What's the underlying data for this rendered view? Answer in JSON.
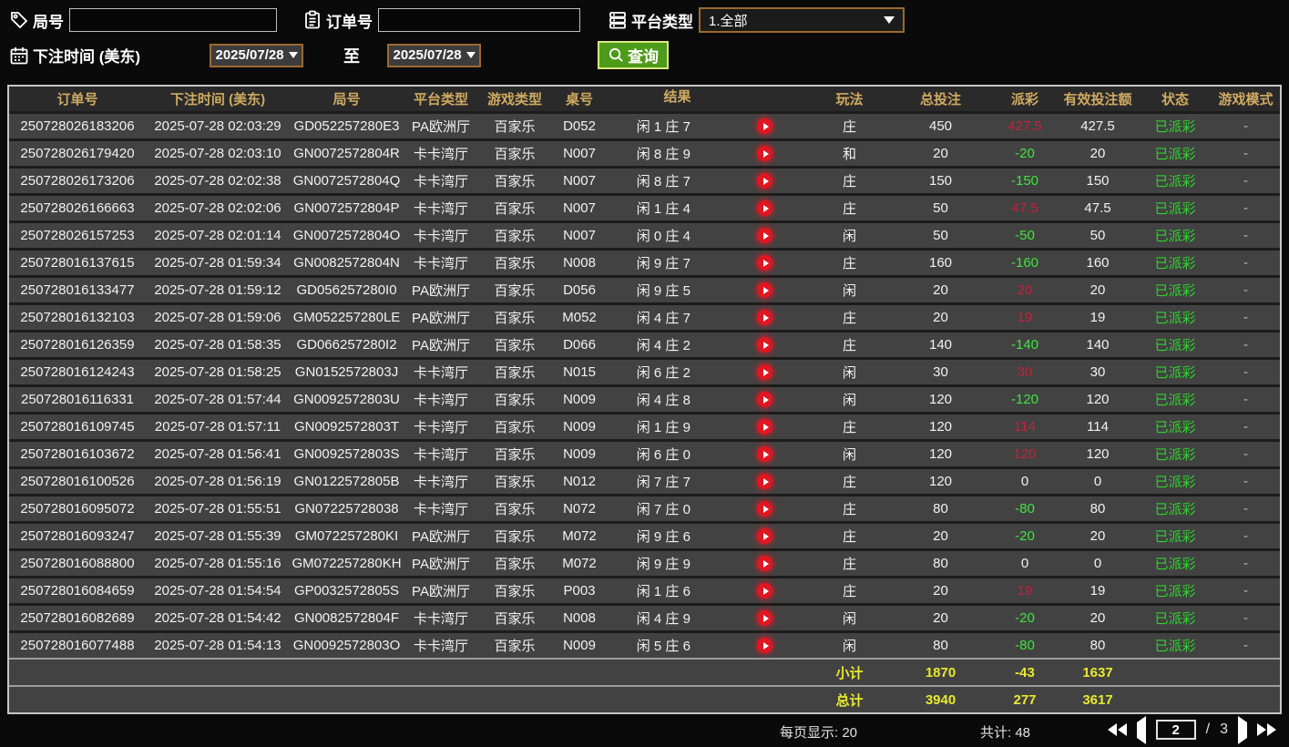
{
  "filters": {
    "game_no_label": "局号",
    "game_no_value": "",
    "order_no_label": "订单号",
    "order_no_value": "",
    "platform_type_label": "平台类型",
    "platform_type_value": "1.全部",
    "bet_time_label": "下注时间 (美东)",
    "date_from": "2025/07/28",
    "to_label": "至",
    "date_to": "2025/07/28",
    "search_button_label": "查询"
  },
  "table": {
    "columns": [
      "订单号",
      "下注时间 (美东)",
      "局号",
      "平台类型",
      "游戏类型",
      "桌号",
      "结果",
      "玩法",
      "总投注",
      "派彩",
      "有效投注额",
      "状态",
      "游戏模式"
    ],
    "rows": [
      {
        "order_no": "250728026183206",
        "bet_time": "2025-07-28 02:03:29",
        "game_no": "GD052257280E3",
        "platform": "PA欧洲厅",
        "game_type": "百家乐",
        "table_no": "D052",
        "result": "闲 1 庄 7",
        "play": "庄",
        "total_bet": "450",
        "payout": "427.5",
        "payout_class": "pos",
        "valid_bet": "427.5",
        "status": "已派彩",
        "game_mode": "-"
      },
      {
        "order_no": "250728026179420",
        "bet_time": "2025-07-28 02:03:10",
        "game_no": "GN0072572804R",
        "platform": "卡卡湾厅",
        "game_type": "百家乐",
        "table_no": "N007",
        "result": "闲 8 庄 9",
        "play": "和",
        "total_bet": "20",
        "payout": "-20",
        "payout_class": "neg",
        "valid_bet": "20",
        "status": "已派彩",
        "game_mode": "-"
      },
      {
        "order_no": "250728026173206",
        "bet_time": "2025-07-28 02:02:38",
        "game_no": "GN0072572804Q",
        "platform": "卡卡湾厅",
        "game_type": "百家乐",
        "table_no": "N007",
        "result": "闲 8 庄 7",
        "play": "庄",
        "total_bet": "150",
        "payout": "-150",
        "payout_class": "neg",
        "valid_bet": "150",
        "status": "已派彩",
        "game_mode": "-"
      },
      {
        "order_no": "250728026166663",
        "bet_time": "2025-07-28 02:02:06",
        "game_no": "GN0072572804P",
        "platform": "卡卡湾厅",
        "game_type": "百家乐",
        "table_no": "N007",
        "result": "闲 1 庄 4",
        "play": "庄",
        "total_bet": "50",
        "payout": "47.5",
        "payout_class": "pos",
        "valid_bet": "47.5",
        "status": "已派彩",
        "game_mode": "-"
      },
      {
        "order_no": "250728026157253",
        "bet_time": "2025-07-28 02:01:14",
        "game_no": "GN0072572804O",
        "platform": "卡卡湾厅",
        "game_type": "百家乐",
        "table_no": "N007",
        "result": "闲 0 庄 4",
        "play": "闲",
        "total_bet": "50",
        "payout": "-50",
        "payout_class": "neg",
        "valid_bet": "50",
        "status": "已派彩",
        "game_mode": "-"
      },
      {
        "order_no": "250728016137615",
        "bet_time": "2025-07-28 01:59:34",
        "game_no": "GN0082572804N",
        "platform": "卡卡湾厅",
        "game_type": "百家乐",
        "table_no": "N008",
        "result": "闲 9 庄 7",
        "play": "庄",
        "total_bet": "160",
        "payout": "-160",
        "payout_class": "neg",
        "valid_bet": "160",
        "status": "已派彩",
        "game_mode": "-"
      },
      {
        "order_no": "250728016133477",
        "bet_time": "2025-07-28 01:59:12",
        "game_no": "GD056257280I0",
        "platform": "PA欧洲厅",
        "game_type": "百家乐",
        "table_no": "D056",
        "result": "闲 9 庄 5",
        "play": "闲",
        "total_bet": "20",
        "payout": "20",
        "payout_class": "pos",
        "valid_bet": "20",
        "status": "已派彩",
        "game_mode": "-"
      },
      {
        "order_no": "250728016132103",
        "bet_time": "2025-07-28 01:59:06",
        "game_no": "GM052257280LE",
        "platform": "PA欧洲厅",
        "game_type": "百家乐",
        "table_no": "M052",
        "result": "闲 4 庄 7",
        "play": "庄",
        "total_bet": "20",
        "payout": "19",
        "payout_class": "pos",
        "valid_bet": "19",
        "status": "已派彩",
        "game_mode": "-"
      },
      {
        "order_no": "250728016126359",
        "bet_time": "2025-07-28 01:58:35",
        "game_no": "GD066257280I2",
        "platform": "PA欧洲厅",
        "game_type": "百家乐",
        "table_no": "D066",
        "result": "闲 4 庄 2",
        "play": "庄",
        "total_bet": "140",
        "payout": "-140",
        "payout_class": "neg",
        "valid_bet": "140",
        "status": "已派彩",
        "game_mode": "-"
      },
      {
        "order_no": "250728016124243",
        "bet_time": "2025-07-28 01:58:25",
        "game_no": "GN0152572803J",
        "platform": "卡卡湾厅",
        "game_type": "百家乐",
        "table_no": "N015",
        "result": "闲 6 庄 2",
        "play": "闲",
        "total_bet": "30",
        "payout": "30",
        "payout_class": "pos",
        "valid_bet": "30",
        "status": "已派彩",
        "game_mode": "-"
      },
      {
        "order_no": "250728016116331",
        "bet_time": "2025-07-28 01:57:44",
        "game_no": "GN0092572803U",
        "platform": "卡卡湾厅",
        "game_type": "百家乐",
        "table_no": "N009",
        "result": "闲 4 庄 8",
        "play": "闲",
        "total_bet": "120",
        "payout": "-120",
        "payout_class": "neg",
        "valid_bet": "120",
        "status": "已派彩",
        "game_mode": "-"
      },
      {
        "order_no": "250728016109745",
        "bet_time": "2025-07-28 01:57:11",
        "game_no": "GN0092572803T",
        "platform": "卡卡湾厅",
        "game_type": "百家乐",
        "table_no": "N009",
        "result": "闲 1 庄 9",
        "play": "庄",
        "total_bet": "120",
        "payout": "114",
        "payout_class": "pos",
        "valid_bet": "114",
        "status": "已派彩",
        "game_mode": "-"
      },
      {
        "order_no": "250728016103672",
        "bet_time": "2025-07-28 01:56:41",
        "game_no": "GN0092572803S",
        "platform": "卡卡湾厅",
        "game_type": "百家乐",
        "table_no": "N009",
        "result": "闲 6 庄 0",
        "play": "闲",
        "total_bet": "120",
        "payout": "120",
        "payout_class": "pos",
        "valid_bet": "120",
        "status": "已派彩",
        "game_mode": "-"
      },
      {
        "order_no": "250728016100526",
        "bet_time": "2025-07-28 01:56:19",
        "game_no": "GN0122572805B",
        "platform": "卡卡湾厅",
        "game_type": "百家乐",
        "table_no": "N012",
        "result": "闲 7 庄 7",
        "play": "庄",
        "total_bet": "120",
        "payout": "0",
        "payout_class": "zero",
        "valid_bet": "0",
        "status": "已派彩",
        "game_mode": "-"
      },
      {
        "order_no": "250728016095072",
        "bet_time": "2025-07-28 01:55:51",
        "game_no": "GN07225728038",
        "platform": "卡卡湾厅",
        "game_type": "百家乐",
        "table_no": "N072",
        "result": "闲 7 庄 0",
        "play": "庄",
        "total_bet": "80",
        "payout": "-80",
        "payout_class": "neg",
        "valid_bet": "80",
        "status": "已派彩",
        "game_mode": "-"
      },
      {
        "order_no": "250728016093247",
        "bet_time": "2025-07-28 01:55:39",
        "game_no": "GM072257280KI",
        "platform": "PA欧洲厅",
        "game_type": "百家乐",
        "table_no": "M072",
        "result": "闲 9 庄 6",
        "play": "庄",
        "total_bet": "20",
        "payout": "-20",
        "payout_class": "neg",
        "valid_bet": "20",
        "status": "已派彩",
        "game_mode": "-"
      },
      {
        "order_no": "250728016088800",
        "bet_time": "2025-07-28 01:55:16",
        "game_no": "GM072257280KH",
        "platform": "PA欧洲厅",
        "game_type": "百家乐",
        "table_no": "M072",
        "result": "闲 9 庄 9",
        "play": "庄",
        "total_bet": "80",
        "payout": "0",
        "payout_class": "zero",
        "valid_bet": "0",
        "status": "已派彩",
        "game_mode": "-"
      },
      {
        "order_no": "250728016084659",
        "bet_time": "2025-07-28 01:54:54",
        "game_no": "GP0032572805S",
        "platform": "PA欧洲厅",
        "game_type": "百家乐",
        "table_no": "P003",
        "result": "闲 1 庄 6",
        "play": "庄",
        "total_bet": "20",
        "payout": "19",
        "payout_class": "pos",
        "valid_bet": "19",
        "status": "已派彩",
        "game_mode": "-"
      },
      {
        "order_no": "250728016082689",
        "bet_time": "2025-07-28 01:54:42",
        "game_no": "GN0082572804F",
        "platform": "卡卡湾厅",
        "game_type": "百家乐",
        "table_no": "N008",
        "result": "闲 4 庄 9",
        "play": "闲",
        "total_bet": "20",
        "payout": "-20",
        "payout_class": "neg",
        "valid_bet": "20",
        "status": "已派彩",
        "game_mode": "-"
      },
      {
        "order_no": "250728016077488",
        "bet_time": "2025-07-28 01:54:13",
        "game_no": "GN0092572803O",
        "platform": "卡卡湾厅",
        "game_type": "百家乐",
        "table_no": "N009",
        "result": "闲 5 庄 6",
        "play": "闲",
        "total_bet": "80",
        "payout": "-80",
        "payout_class": "neg",
        "valid_bet": "80",
        "status": "已派彩",
        "game_mode": "-"
      }
    ],
    "subtotal": {
      "label": "小计",
      "total_bet": "1870",
      "payout": "-43",
      "valid_bet": "1637"
    },
    "total": {
      "label": "总计",
      "total_bet": "3940",
      "payout": "277",
      "valid_bet": "3617"
    }
  },
  "pagination": {
    "per_page_label": "每页显示: 20",
    "grand_total_label": "共计: 48",
    "current_page": "2",
    "separator": "/",
    "total_pages": "3"
  },
  "colors": {
    "header_gold": "#d0aa62",
    "payout_positive_red": "#c2233a",
    "payout_negative_green": "#3fe43f",
    "status_green": "#2fd32f",
    "totals_yellow": "#e9e92e",
    "accent_brown_border": "#9a6a30",
    "search_button_green": "#4e9b1b"
  }
}
